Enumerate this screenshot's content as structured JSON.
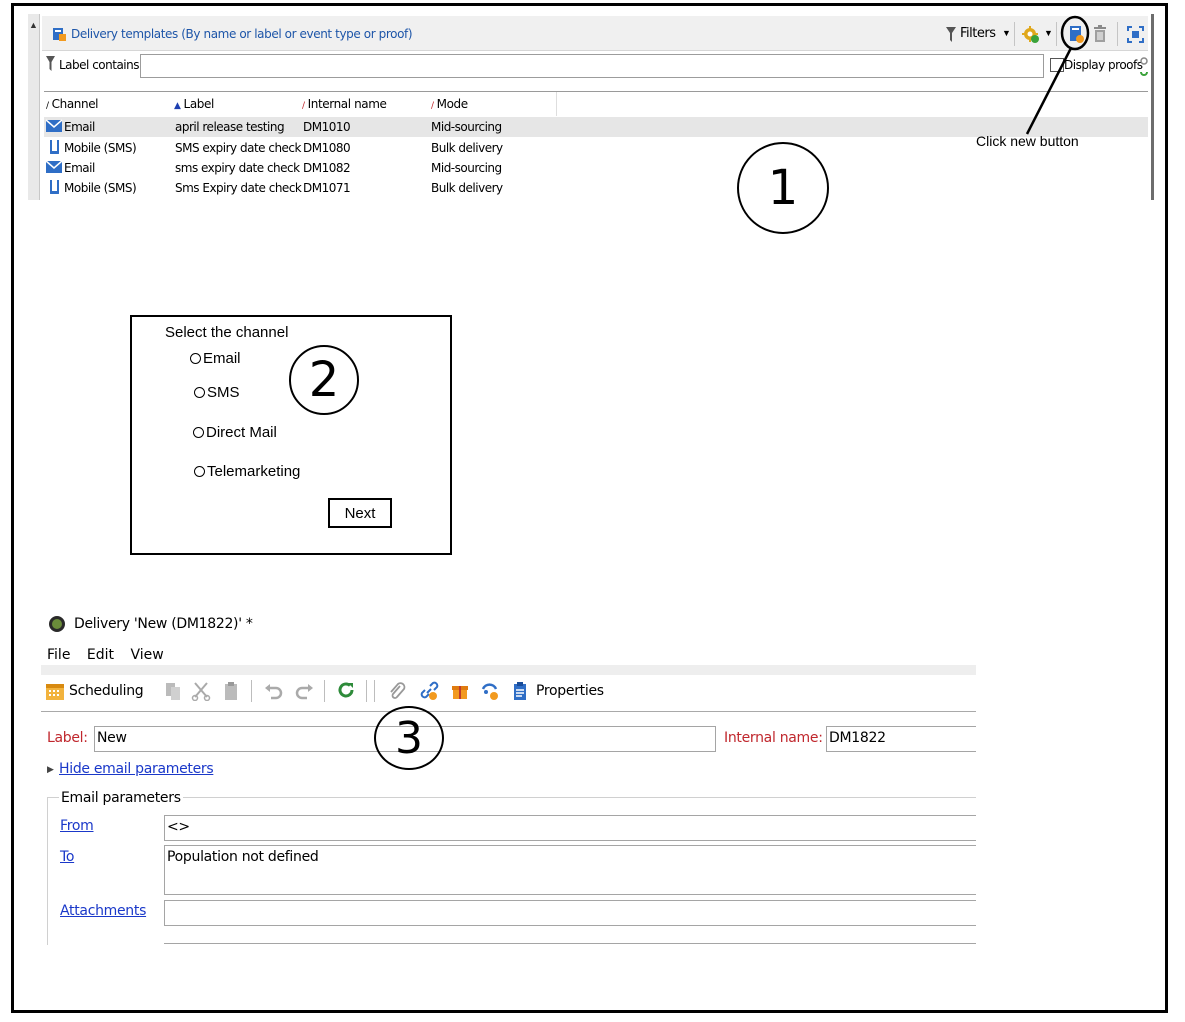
{
  "templates_panel": {
    "title": "Delivery templates (By name or label or event type or proof)",
    "filters_label": "Filters",
    "label_contains": "Label contains:",
    "label_value": "",
    "display_proofs": "Display proofs",
    "columns": [
      "Channel",
      "Label",
      "Internal name",
      "Mode"
    ],
    "rows": [
      {
        "channel": "Email",
        "label": "april release testing",
        "internal_name": "DM1010",
        "mode": "Mid-sourcing"
      },
      {
        "channel": "Mobile (SMS)",
        "label": "SMS expiry date check",
        "internal_name": "DM1080",
        "mode": "Bulk delivery"
      },
      {
        "channel": "Email",
        "label": "sms expiry date check",
        "internal_name": "DM1082",
        "mode": "Mid-sourcing"
      },
      {
        "channel": "Mobile (SMS)",
        "label": "Sms Expiry date check",
        "internal_name": "DM1071",
        "mode": "Bulk delivery"
      }
    ]
  },
  "annotations": {
    "click_new": "Click new button",
    "step1": "1",
    "step2": "2",
    "step3": "3"
  },
  "channel_dialog": {
    "title": "Select the channel",
    "options": [
      "Email",
      "SMS",
      "Direct Mail",
      "Telemarketing"
    ],
    "next_label": "Next"
  },
  "delivery_form": {
    "title": "Delivery 'New (DM1822)' *",
    "menu": [
      "File",
      "Edit",
      "View"
    ],
    "scheduling_label": "Scheduling",
    "properties_label": "Properties",
    "label_caption": "Label:",
    "label_value": "New",
    "internal_name_caption": "Internal name:",
    "internal_name_value": "DM1822",
    "hide_email_params": "Hide email parameters",
    "group_title": "Email parameters",
    "from_caption": "From",
    "from_value": "<>",
    "to_caption": "To",
    "to_value": "Population not defined",
    "attachments_caption": "Attachments",
    "attachments_value": ""
  },
  "colors": {
    "link_blue": "#1a38c9",
    "required_red": "#c0272d",
    "title_blue": "#1d55a8",
    "selected_row": "#e6e6e6"
  }
}
